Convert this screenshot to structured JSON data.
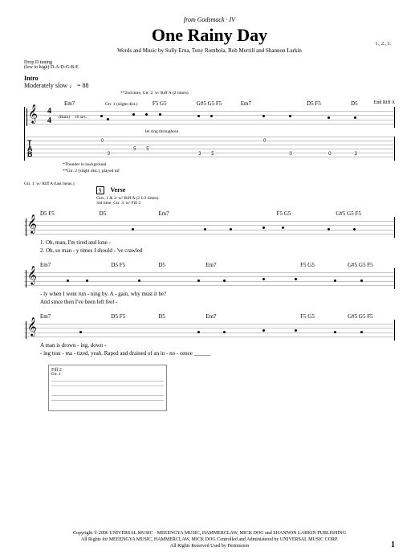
{
  "header": {
    "from_line": "from Godsmack · IV",
    "title": "One Rainy Day",
    "credits": "Words and Music by Sully Erna, Tony Rombola, Rob Merrill and Shannon Larkin"
  },
  "tuning": {
    "line1": "Drop D tuning",
    "line2": "(low to high) D-A-D-G-B-E"
  },
  "topright_box": "1., 2., 3.",
  "intro": {
    "label": "Intro",
    "tempo": "Moderately slow ♩ = 88",
    "instruction": "**2nd time, Gtr. 2: w/ Riff A (2 times)",
    "chords": [
      "Em7",
      "",
      "F5 G5",
      "G#5 G5 F5",
      "Em7",
      "",
      "D5 F5",
      "D5"
    ],
    "end_label": "End Riff A",
    "rest_label": "(Rain)",
    "bars_rest": "10 sec.",
    "gtr_note": "Gtr. 1 (slight dist.)",
    "tech_note": "let ring throughout",
    "footnote1": "*Thunder in background",
    "footnote2": "**Gtr. 2 (slight dist.), played mf"
  },
  "system2": {
    "left_label": "Gtr. 1: w/ Riff A (last meas.)",
    "verse_marker": "§",
    "verse_label": "Verse",
    "instruction": "Gtrs. 1 & 2: w/ Riff A (2 1/2 times)\n3rd time, Gtr. 3: w/ Fill 2",
    "chords": [
      "D5  F5",
      "D5",
      "Em7",
      "",
      "",
      "F5 G5",
      "G#5 G5 F5"
    ],
    "lyrics_line1": "1. Oh,          man,                                       I'm    tired    and    lone  -",
    "lyrics_line2": "2. Oh,                    so    man - y    times                        I    should - 've    crawled"
  },
  "system3": {
    "chords": [
      "Em7",
      "",
      "D5  F5",
      "D5",
      "Em7",
      "",
      "",
      "F5 G5",
      "G#5 G5 F5"
    ],
    "lyrics_line1": "- ly    when    I    went    run - ning    by.                    A  -  gain,                                why    must    it    be?",
    "lyrics_line2": "                                                                    And    since    then    I've            been    left    feel  -"
  },
  "system4": {
    "chords": [
      "Em7",
      "",
      "D5  F5",
      "D5",
      "Em7",
      "",
      "",
      "F5 G5",
      "G#5 G5 F5"
    ],
    "lyrics_line1": "                                                                    A          man                    is    drown - ing,    down  -",
    "lyrics_line2": "- ing  trau - ma - tized,        yeah.                        Raped    and    drained    of    an    in - no - cence    ______"
  },
  "riff_box": {
    "label": "Fill 2",
    "gtr": "Gtr. 3"
  },
  "footer": {
    "line1": "Copyright © 2006 UNIVERSAL MUSIC · MEEENGYA MUSIC, HAMMERCLAW, MICK DOG and SHANNON LARKIN PUBLISHING",
    "line2": "All Rights for MEEENGYA MUSIC, HAMMERCLAW, MICK DOG Controlled and Administered by UNIVERSAL MUSIC CORP.",
    "line3": "All Rights Reserved   Used by Permission"
  },
  "page_number": "1"
}
